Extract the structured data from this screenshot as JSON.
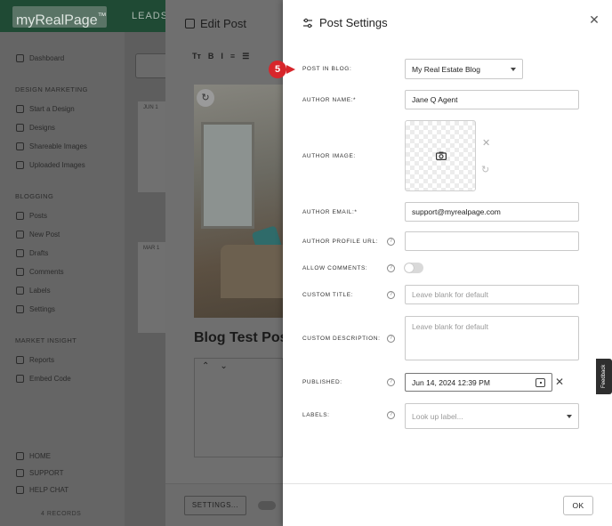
{
  "app": {
    "logo": "myRealPage",
    "logo_tm": "™",
    "topnav": "LEADS"
  },
  "sidebar": {
    "dashboard": "Dashboard",
    "design_head": "DESIGN MARKETING",
    "design_items": [
      "Start a Design",
      "Designs",
      "Shareable Images",
      "Uploaded Images"
    ],
    "blogging_head": "BLOGGING",
    "blogging_items": [
      "Posts",
      "New Post",
      "Drafts",
      "Comments",
      "Labels",
      "Settings"
    ],
    "market_head": "MARKET INSIGHT",
    "market_items": [
      "Reports",
      "Embed Code"
    ],
    "bottom_items": [
      "HOME",
      "SUPPORT",
      "HELP CHAT"
    ],
    "records": "4 RECORDS"
  },
  "mid": {
    "card1_date": "JUN 1",
    "card2_date": "MAR 1"
  },
  "edit_post": {
    "title": "Edit Post",
    "toolbar": [
      "Tт",
      "B",
      "I",
      "≡",
      "☰"
    ],
    "blog_title": "Blog Test Pos",
    "settings_button": "SETTINGS..."
  },
  "settings": {
    "title": "Post Settings",
    "step_number": "5",
    "post_in_blog": {
      "label": "POST IN BLOG:",
      "value": "My Real Estate Blog"
    },
    "author_name": {
      "label": "AUTHOR NAME:*",
      "value": "Jane Q Agent"
    },
    "author_image": {
      "label": "AUTHOR IMAGE:"
    },
    "author_email": {
      "label": "AUTHOR EMAIL:*",
      "value": "support@myrealpage.com"
    },
    "author_profile_url": {
      "label": "AUTHOR PROFILE URL:",
      "value": ""
    },
    "allow_comments": {
      "label": "ALLOW COMMENTS:",
      "enabled": false
    },
    "custom_title": {
      "label": "CUSTOM TITLE:",
      "placeholder": "Leave blank for default"
    },
    "custom_description": {
      "label": "CUSTOM DESCRIPTION:",
      "placeholder": "Leave blank for default"
    },
    "published": {
      "label": "PUBLISHED:",
      "value": "Jun 14, 2024 12:39 PM"
    },
    "labels": {
      "label": "LABELS:",
      "placeholder": "Look up label..."
    },
    "ok_button": "OK"
  },
  "feedback_tab": "Feedback",
  "colors": {
    "topbar": "#1f4a34",
    "step_marker": "#d7262b",
    "drawer_bg": "#ffffff"
  }
}
